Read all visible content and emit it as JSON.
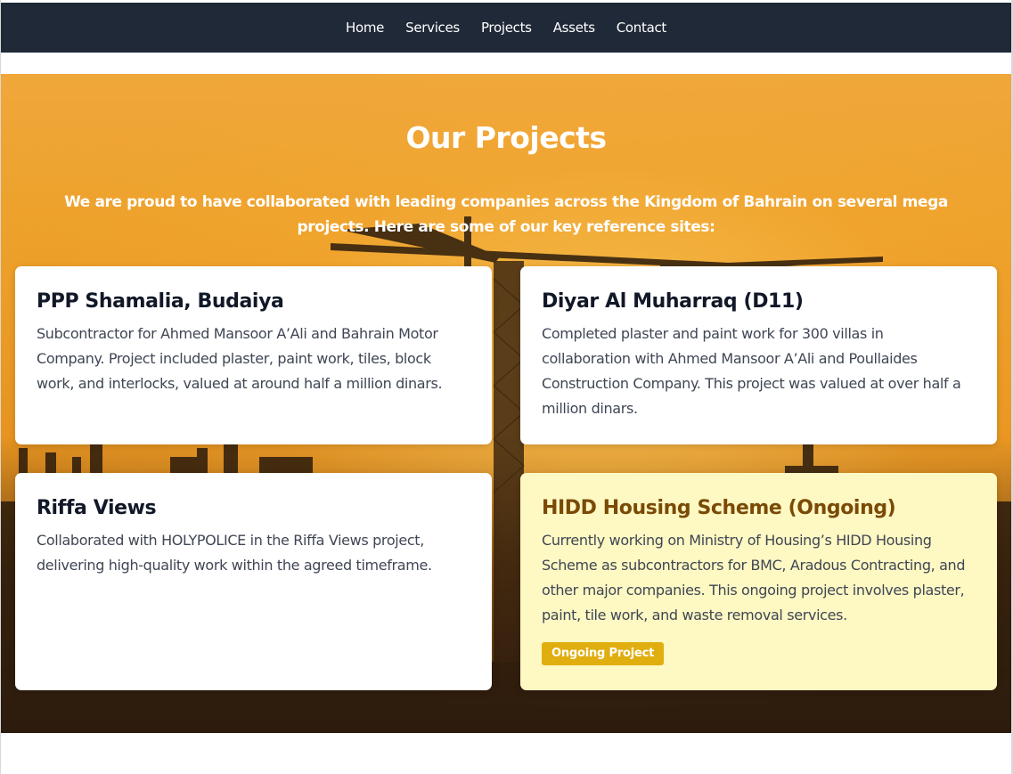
{
  "nav": {
    "items": [
      {
        "label": "Home"
      },
      {
        "label": "Services"
      },
      {
        "label": "Projects"
      },
      {
        "label": "Assets"
      },
      {
        "label": "Contact"
      }
    ]
  },
  "projects": {
    "title": "Our Projects",
    "intro": "We are proud to have collaborated with leading companies across the Kingdom of Bahrain on several mega projects. Here are some of our key reference sites:",
    "cards": [
      {
        "title": "PPP Shamalia, Budaiya",
        "description": "Subcontractor for Ahmed Mansoor A’Ali and Bahrain Motor Company. Project included plaster, paint work, tiles, block work, and interlocks, valued at around half a million dinars."
      },
      {
        "title": "Diyar Al Muharraq (D11)",
        "description": "Completed plaster and paint work for 300 villas in collaboration with Ahmed Mansoor A’Ali and Poullaides Construction Company. This project was valued at over half a million dinars."
      },
      {
        "title": "Riffa Views",
        "description": "Collaborated with HOLYPOLICE in the Riffa Views project, delivering high-quality work within the agreed timeframe."
      },
      {
        "title": "HIDD Housing Scheme (Ongoing)",
        "description": "Currently working on Ministry of Housing’s HIDD Housing Scheme as subcontractors for BMC, Aradous Contracting, and other major companies. This ongoing project involves plaster, paint, tile work, and waste removal services.",
        "badge": "Ongoing Project"
      }
    ]
  },
  "colors": {
    "nav_bg": "#1f2937",
    "hero_orange": "#eda12a",
    "highlight_card_bg": "#fef8c3",
    "highlight_title": "#7a4a06",
    "badge_bg": "#e0ae0f"
  },
  "background_image": {
    "subject": "construction-cranes-silhouette-sunset"
  }
}
